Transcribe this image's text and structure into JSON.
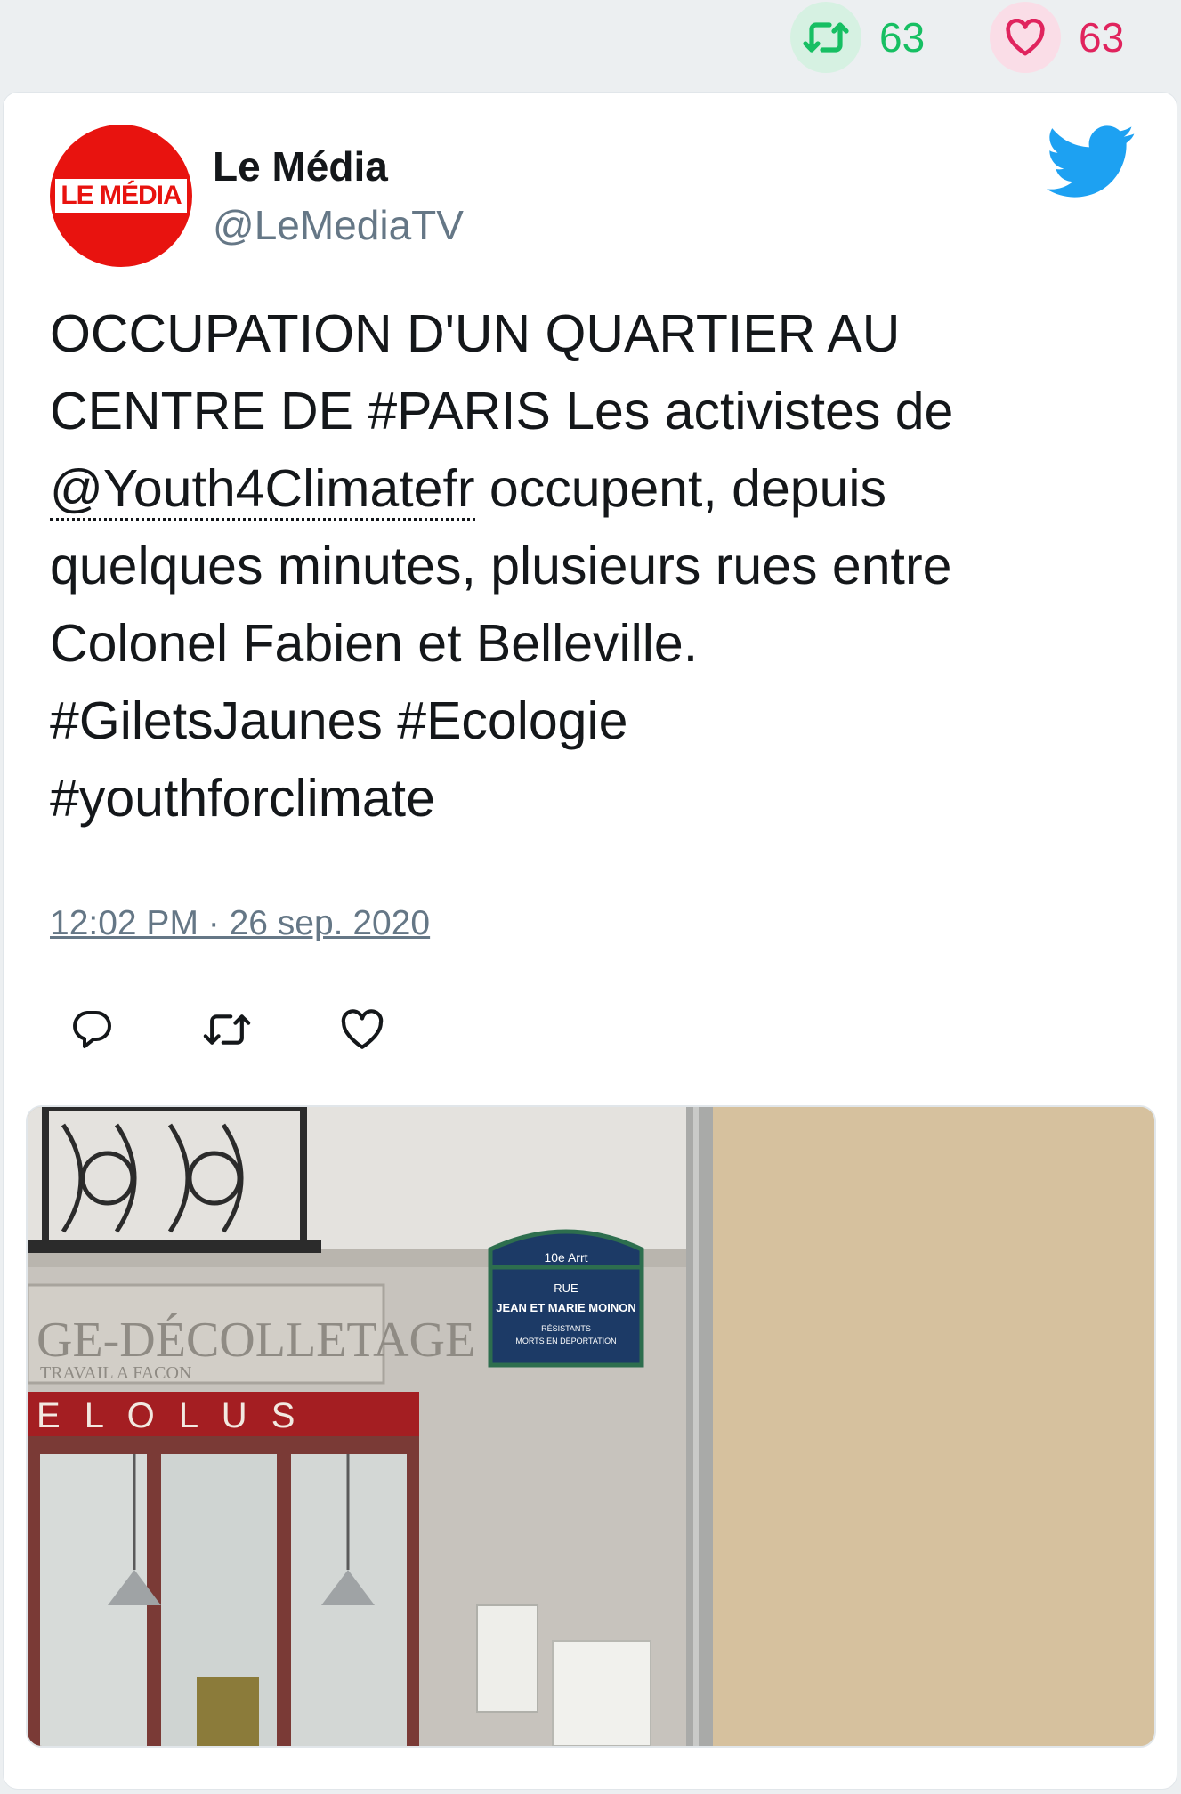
{
  "stats": {
    "retweet_count": "63",
    "like_count": "63"
  },
  "author": {
    "display_name": "Le Média",
    "handle": "@LeMediaTV",
    "avatar_text": "LE MÉDIA"
  },
  "tweet": {
    "text_line1": "OCCUPATION D'UN QUARTIER AU",
    "text_line2": "CENTRE DE #PARIS Les activistes de",
    "mention": "@Youth4Climatefr",
    "text_line3_rest": " occupent, depuis",
    "text_line4": "quelques minutes, plusieurs rues entre",
    "text_line5": "Colonel Fabien et Belleville.",
    "text_line6": "#GiletsJaunes #Ecologie",
    "text_line7": "#youthforclimate",
    "timestamp": "12:02 PM · 26 sep. 2020"
  },
  "media": {
    "street_sign_arrondissement": "10e Arrt",
    "street_sign_line1": "RUE",
    "street_sign_line2": "JEAN ET MARIE MOINON",
    "street_sign_line3": "RÉSISTANTS",
    "street_sign_line4": "MORTS EN DÉPORTATION",
    "shop_sign": "GE-DÉCOLLETAGE",
    "shop_subsign": "TRAVAIL A FACON",
    "red_sign": "E L O L U S"
  },
  "icons": {
    "retweet_icon": "retweet-icon",
    "like_icon": "heart-icon",
    "reply_icon": "reply-icon",
    "bird_icon": "twitter-bird-icon"
  },
  "colors": {
    "retweet": "#17bf63",
    "like": "#e0245e",
    "twitter_blue": "#1da1f2",
    "avatar_red": "#e8130f"
  }
}
